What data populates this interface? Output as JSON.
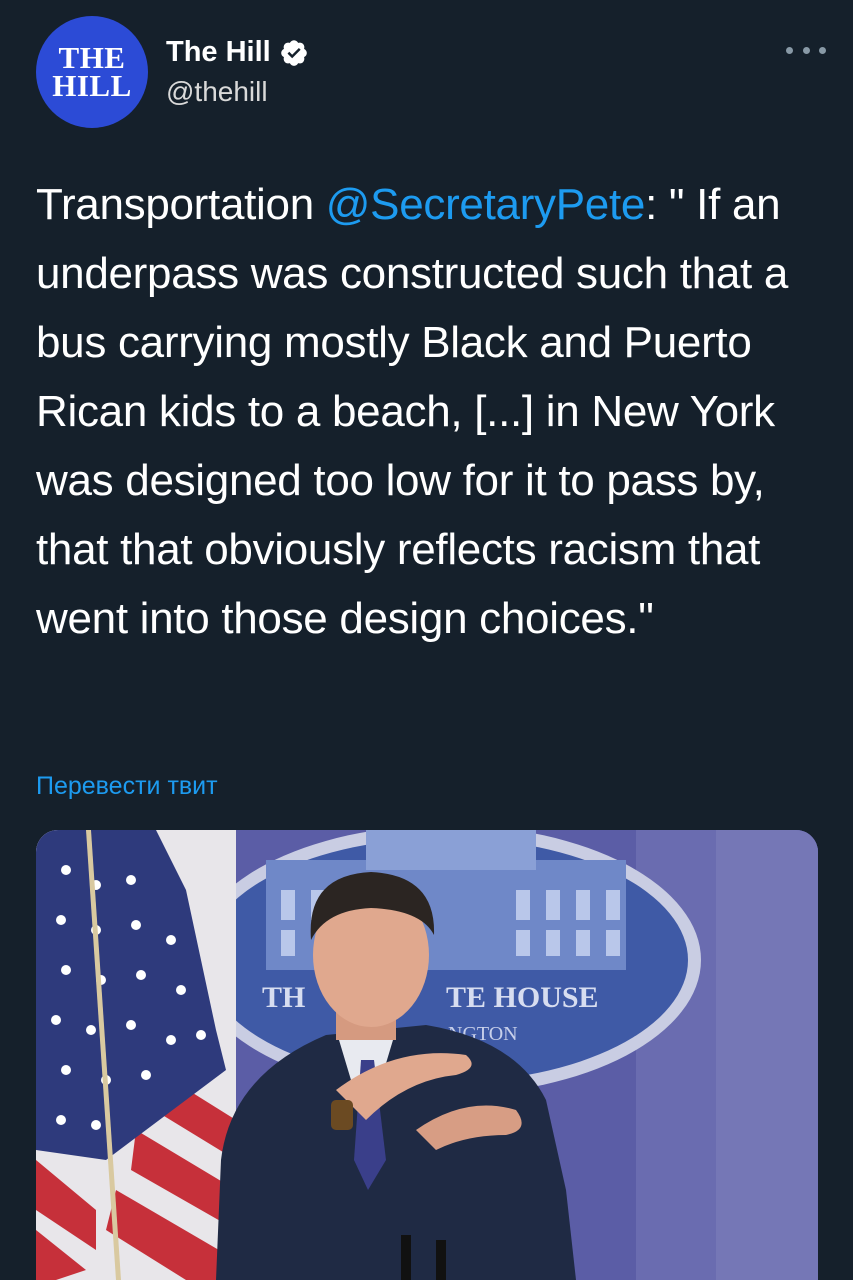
{
  "author": {
    "avatar_line1": "THE",
    "avatar_line2": "HILL",
    "name": "The Hill",
    "handle": "@thehill",
    "verified_icon": "verified-badge-icon",
    "more_icon": "more-options-icon"
  },
  "tweet": {
    "text_before": "Transportation ",
    "mention": "@SecretaryPete",
    "text_after": ": \" If an underpass was constructed such that a bus carrying mostly Black and Puerto Rican kids to a beach, [...] in New York was designed too low for it to pass by, that that obviously reflects racism that went into those design choices.\"",
    "translate_label": "Перевести твит"
  },
  "media": {
    "seal_text_left": "TH",
    "seal_text_right": "TE HOUSE",
    "seal_subtext": "NGTON"
  },
  "colors": {
    "background": "#15202b",
    "accent": "#1d9bf0",
    "avatar_bg": "#2c4bd6"
  }
}
